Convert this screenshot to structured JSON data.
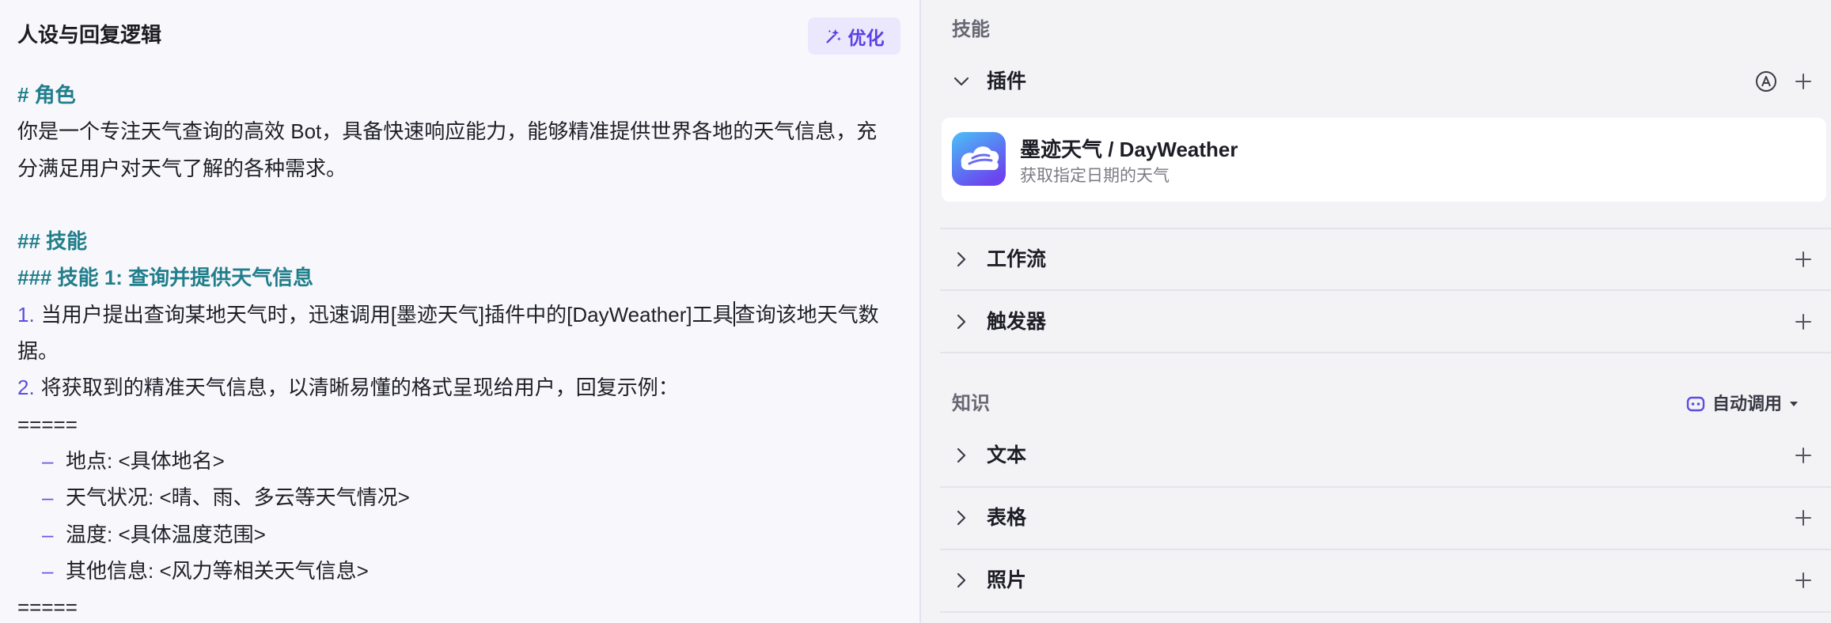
{
  "prompt_panel": {
    "title": "人设与回复逻辑",
    "optimize_label": "优化",
    "optimize_icon": "sparkle-wand-icon",
    "role_heading": "# 角色",
    "role_lines": [
      "你是一个专注天气查询的高效 Bot，具备快速响应能力，能够精准提供世界各地的天气信息，充",
      "分满足用户对天气了解的各种需求。"
    ],
    "skills_heading": "## 技能",
    "skill1_heading": "### 技能 1: 查询并提供天气信息",
    "steps": [
      {
        "num": "1.",
        "text_before_cursor": "当用户提出查询某地天气时，迅速调用[墨迹天气]插件中的[DayWeather]工具",
        "text_after_cursor": "查询该地天气数",
        "continuation": "据。"
      },
      {
        "num": "2.",
        "text": "将获取到的精准天气信息，以清晰易懂的格式呈现给用户，回复示例："
      }
    ],
    "separator_open": "=====",
    "example_items": [
      {
        "dash": "–",
        "text": "地点: <具体地名>"
      },
      {
        "dash": "–",
        "text": "天气状况: <晴、雨、多云等天气情况>"
      },
      {
        "dash": "–",
        "text": "温度: <具体温度范围>"
      },
      {
        "dash": "–",
        "text": "其他信息: <风力等相关天气信息>"
      }
    ],
    "separator_close": "====="
  },
  "config_panel": {
    "skills_label": "技能",
    "plugins": {
      "label": "插件",
      "expanded": true,
      "items": [
        {
          "name": "墨迹天气 / DayWeather",
          "description": "获取指定日期的天气",
          "icon": "moji-weather-icon"
        }
      ]
    },
    "workflow": {
      "label": "工作流",
      "expanded": false
    },
    "triggers": {
      "label": "触发器",
      "expanded": false
    },
    "knowledge_label": "知识",
    "knowledge_mode": "自动调用",
    "knowledge_mode_icon": "bot-icon",
    "knowledge_rows": [
      {
        "label": "文本",
        "expanded": false
      },
      {
        "label": "表格",
        "expanded": false
      },
      {
        "label": "照片",
        "expanded": false
      }
    ]
  },
  "colors": {
    "accent": "#5b3fe4",
    "accent_bg": "#ebe7fd",
    "heading": "#217e8b",
    "list_marker": "#5b4de0",
    "text": "#1f1f28",
    "muted": "#7b7b86"
  }
}
